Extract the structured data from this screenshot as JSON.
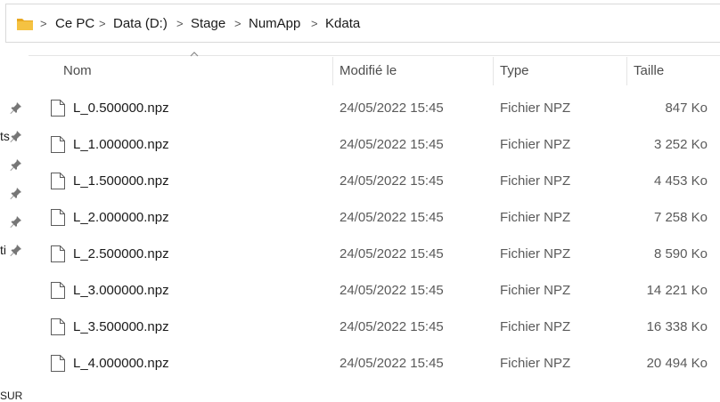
{
  "breadcrumb": {
    "items": [
      "Ce PC",
      "Data (D:)",
      "Stage",
      "NumApp",
      "Kdata"
    ],
    "separator": ">"
  },
  "columns": {
    "name": "Nom",
    "modified": "Modifié le",
    "type": "Type",
    "size": "Taille"
  },
  "files": [
    {
      "name": "L_0.500000.npz",
      "modified": "24/05/2022 15:45",
      "type": "Fichier NPZ",
      "size": "847 Ko"
    },
    {
      "name": "L_1.000000.npz",
      "modified": "24/05/2022 15:45",
      "type": "Fichier NPZ",
      "size": "3 252 Ko"
    },
    {
      "name": "L_1.500000.npz",
      "modified": "24/05/2022 15:45",
      "type": "Fichier NPZ",
      "size": "4 453 Ko"
    },
    {
      "name": "L_2.000000.npz",
      "modified": "24/05/2022 15:45",
      "type": "Fichier NPZ",
      "size": "7 258 Ko"
    },
    {
      "name": "L_2.500000.npz",
      "modified": "24/05/2022 15:45",
      "type": "Fichier NPZ",
      "size": "8 590 Ko"
    },
    {
      "name": "L_3.000000.npz",
      "modified": "24/05/2022 15:45",
      "type": "Fichier NPZ",
      "size": "14 221 Ko"
    },
    {
      "name": "L_3.500000.npz",
      "modified": "24/05/2022 15:45",
      "type": "Fichier NPZ",
      "size": "16 338 Ko"
    },
    {
      "name": "L_4.000000.npz",
      "modified": "24/05/2022 15:45",
      "type": "Fichier NPZ",
      "size": "20 494 Ko"
    }
  ],
  "nav_pane": {
    "fragments": [
      "ts",
      "ti",
      "SUR"
    ]
  },
  "colors": {
    "folder": "#f5c242",
    "pin": "#767676",
    "border": "#d9d9d9"
  }
}
